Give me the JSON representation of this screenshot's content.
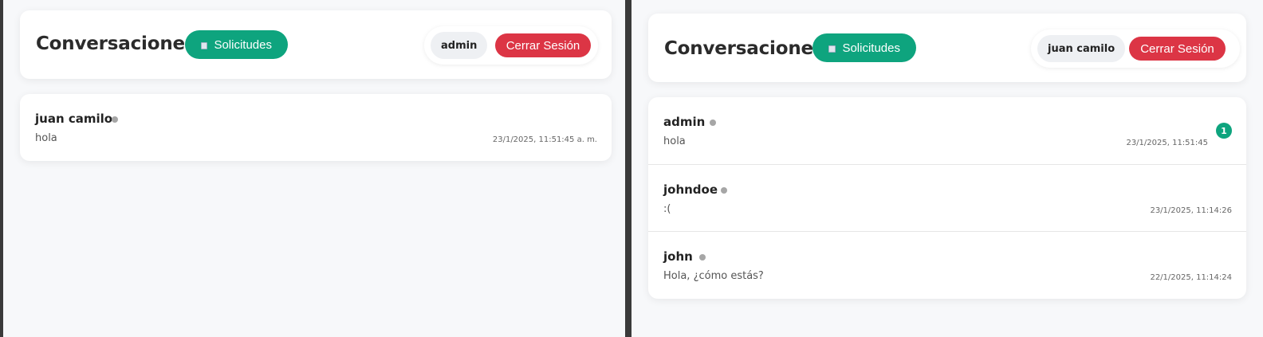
{
  "left": {
    "header": {
      "title": "Conversaciones",
      "requests_label": "Solicitudes",
      "username": "admin",
      "logout_label": "Cerrar Sesión"
    },
    "conversations": [
      {
        "name": "juan camilo",
        "message": "hola",
        "time": "23/1/2025, 11:51:45 a. m."
      }
    ]
  },
  "right": {
    "header": {
      "title": "Conversaciones",
      "requests_label": "Solicitudes",
      "username": "juan camilo",
      "logout_label": "Cerrar Sesión"
    },
    "conversations": [
      {
        "name": "admin",
        "message": "hola",
        "time": "23/1/2025, 11:51:45",
        "unread": "1"
      },
      {
        "name": "johndoe",
        "message": ":(",
        "time": "23/1/2025, 11:14:26"
      },
      {
        "name": "john",
        "message": "Hola, ¿cómo estás?",
        "time": "22/1/2025, 11:14:24"
      }
    ]
  },
  "colors": {
    "accent_green": "#0ea47e",
    "logout_red": "#dc3545",
    "status_offline": "#a6a6a6",
    "background": "#f7f8fa"
  },
  "icons": {
    "requests": "mail-icon",
    "status": "status-dot"
  }
}
